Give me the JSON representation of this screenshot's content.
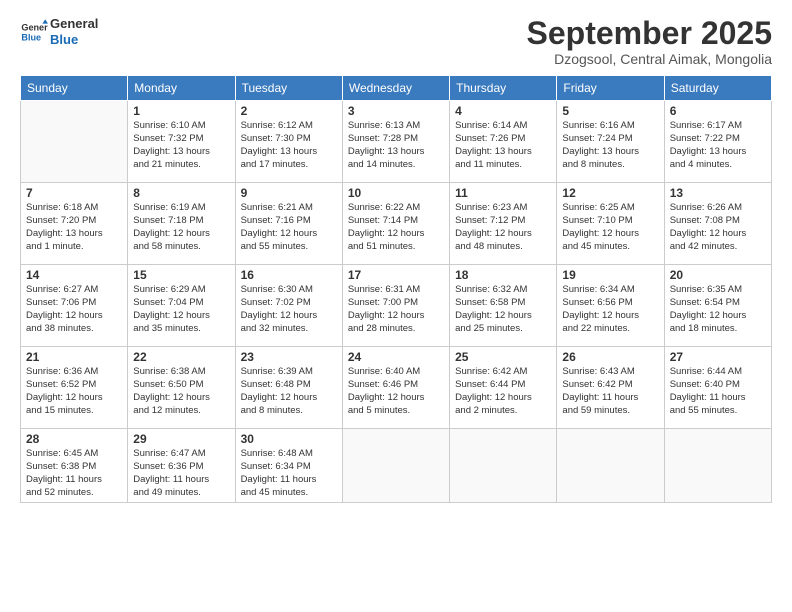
{
  "logo": {
    "line1": "General",
    "line2": "Blue"
  },
  "title": "September 2025",
  "subtitle": "Dzogsool, Central Aimak, Mongolia",
  "days_header": [
    "Sunday",
    "Monday",
    "Tuesday",
    "Wednesday",
    "Thursday",
    "Friday",
    "Saturday"
  ],
  "weeks": [
    [
      {
        "day": "",
        "info": ""
      },
      {
        "day": "1",
        "info": "Sunrise: 6:10 AM\nSunset: 7:32 PM\nDaylight: 13 hours\nand 21 minutes."
      },
      {
        "day": "2",
        "info": "Sunrise: 6:12 AM\nSunset: 7:30 PM\nDaylight: 13 hours\nand 17 minutes."
      },
      {
        "day": "3",
        "info": "Sunrise: 6:13 AM\nSunset: 7:28 PM\nDaylight: 13 hours\nand 14 minutes."
      },
      {
        "day": "4",
        "info": "Sunrise: 6:14 AM\nSunset: 7:26 PM\nDaylight: 13 hours\nand 11 minutes."
      },
      {
        "day": "5",
        "info": "Sunrise: 6:16 AM\nSunset: 7:24 PM\nDaylight: 13 hours\nand 8 minutes."
      },
      {
        "day": "6",
        "info": "Sunrise: 6:17 AM\nSunset: 7:22 PM\nDaylight: 13 hours\nand 4 minutes."
      }
    ],
    [
      {
        "day": "7",
        "info": "Sunrise: 6:18 AM\nSunset: 7:20 PM\nDaylight: 13 hours\nand 1 minute."
      },
      {
        "day": "8",
        "info": "Sunrise: 6:19 AM\nSunset: 7:18 PM\nDaylight: 12 hours\nand 58 minutes."
      },
      {
        "day": "9",
        "info": "Sunrise: 6:21 AM\nSunset: 7:16 PM\nDaylight: 12 hours\nand 55 minutes."
      },
      {
        "day": "10",
        "info": "Sunrise: 6:22 AM\nSunset: 7:14 PM\nDaylight: 12 hours\nand 51 minutes."
      },
      {
        "day": "11",
        "info": "Sunrise: 6:23 AM\nSunset: 7:12 PM\nDaylight: 12 hours\nand 48 minutes."
      },
      {
        "day": "12",
        "info": "Sunrise: 6:25 AM\nSunset: 7:10 PM\nDaylight: 12 hours\nand 45 minutes."
      },
      {
        "day": "13",
        "info": "Sunrise: 6:26 AM\nSunset: 7:08 PM\nDaylight: 12 hours\nand 42 minutes."
      }
    ],
    [
      {
        "day": "14",
        "info": "Sunrise: 6:27 AM\nSunset: 7:06 PM\nDaylight: 12 hours\nand 38 minutes."
      },
      {
        "day": "15",
        "info": "Sunrise: 6:29 AM\nSunset: 7:04 PM\nDaylight: 12 hours\nand 35 minutes."
      },
      {
        "day": "16",
        "info": "Sunrise: 6:30 AM\nSunset: 7:02 PM\nDaylight: 12 hours\nand 32 minutes."
      },
      {
        "day": "17",
        "info": "Sunrise: 6:31 AM\nSunset: 7:00 PM\nDaylight: 12 hours\nand 28 minutes."
      },
      {
        "day": "18",
        "info": "Sunrise: 6:32 AM\nSunset: 6:58 PM\nDaylight: 12 hours\nand 25 minutes."
      },
      {
        "day": "19",
        "info": "Sunrise: 6:34 AM\nSunset: 6:56 PM\nDaylight: 12 hours\nand 22 minutes."
      },
      {
        "day": "20",
        "info": "Sunrise: 6:35 AM\nSunset: 6:54 PM\nDaylight: 12 hours\nand 18 minutes."
      }
    ],
    [
      {
        "day": "21",
        "info": "Sunrise: 6:36 AM\nSunset: 6:52 PM\nDaylight: 12 hours\nand 15 minutes."
      },
      {
        "day": "22",
        "info": "Sunrise: 6:38 AM\nSunset: 6:50 PM\nDaylight: 12 hours\nand 12 minutes."
      },
      {
        "day": "23",
        "info": "Sunrise: 6:39 AM\nSunset: 6:48 PM\nDaylight: 12 hours\nand 8 minutes."
      },
      {
        "day": "24",
        "info": "Sunrise: 6:40 AM\nSunset: 6:46 PM\nDaylight: 12 hours\nand 5 minutes."
      },
      {
        "day": "25",
        "info": "Sunrise: 6:42 AM\nSunset: 6:44 PM\nDaylight: 12 hours\nand 2 minutes."
      },
      {
        "day": "26",
        "info": "Sunrise: 6:43 AM\nSunset: 6:42 PM\nDaylight: 11 hours\nand 59 minutes."
      },
      {
        "day": "27",
        "info": "Sunrise: 6:44 AM\nSunset: 6:40 PM\nDaylight: 11 hours\nand 55 minutes."
      }
    ],
    [
      {
        "day": "28",
        "info": "Sunrise: 6:45 AM\nSunset: 6:38 PM\nDaylight: 11 hours\nand 52 minutes."
      },
      {
        "day": "29",
        "info": "Sunrise: 6:47 AM\nSunset: 6:36 PM\nDaylight: 11 hours\nand 49 minutes."
      },
      {
        "day": "30",
        "info": "Sunrise: 6:48 AM\nSunset: 6:34 PM\nDaylight: 11 hours\nand 45 minutes."
      },
      {
        "day": "",
        "info": ""
      },
      {
        "day": "",
        "info": ""
      },
      {
        "day": "",
        "info": ""
      },
      {
        "day": "",
        "info": ""
      }
    ]
  ]
}
